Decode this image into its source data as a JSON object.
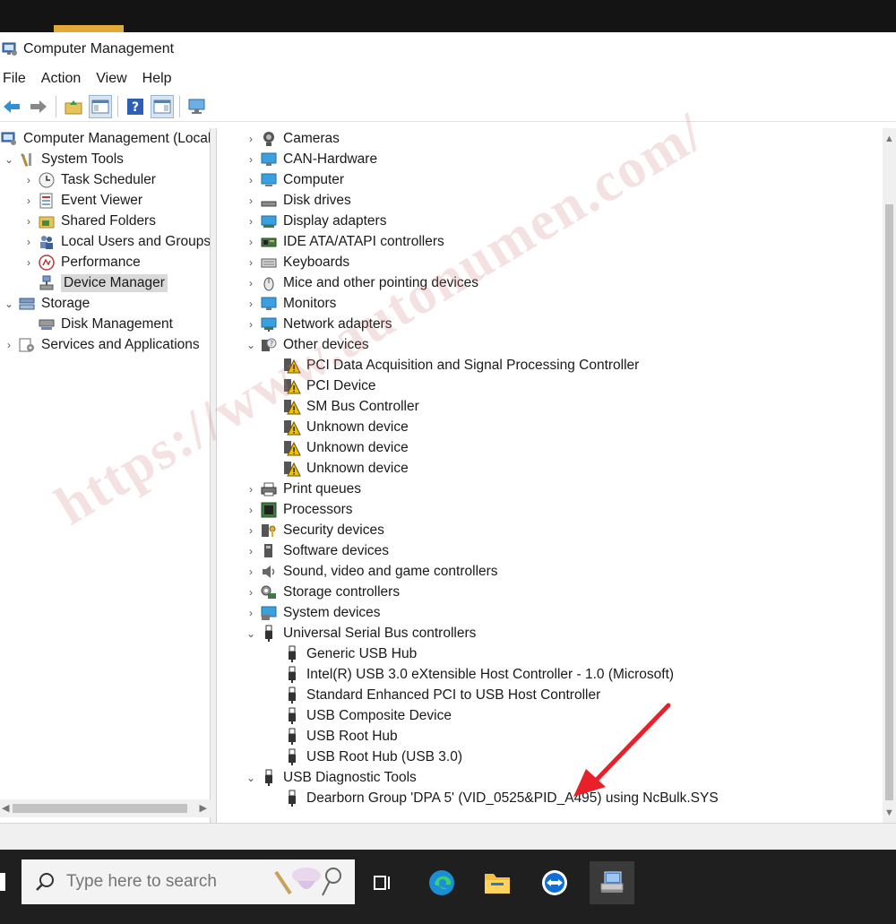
{
  "window": {
    "title": "Computer Management"
  },
  "menu": [
    "File",
    "Action",
    "View",
    "Help"
  ],
  "left_tree": {
    "root": "Computer Management (Local",
    "system_tools": "System Tools",
    "task_scheduler": "Task Scheduler",
    "event_viewer": "Event Viewer",
    "shared_folders": "Shared Folders",
    "local_users": "Local Users and Groups",
    "performance": "Performance",
    "device_manager": "Device Manager",
    "storage": "Storage",
    "disk_management": "Disk Management",
    "services": "Services and Applications"
  },
  "devices": {
    "cameras": "Cameras",
    "can_hardware": "CAN-Hardware",
    "computer": "Computer",
    "disk_drives": "Disk drives",
    "display_adapters": "Display adapters",
    "ide": "IDE ATA/ATAPI controllers",
    "keyboards": "Keyboards",
    "mice": "Mice and other pointing devices",
    "monitors": "Monitors",
    "network_adapters": "Network adapters",
    "other_devices": "Other devices",
    "other_children": [
      "PCI Data Acquisition and Signal Processing Controller",
      "PCI Device",
      "SM Bus Controller",
      "Unknown device",
      "Unknown device",
      "Unknown device"
    ],
    "print_queues": "Print queues",
    "processors": "Processors",
    "security_devices": "Security devices",
    "software_devices": "Software devices",
    "sound": "Sound, video and game controllers",
    "storage_controllers": "Storage controllers",
    "system_devices": "System devices",
    "usb_controllers": "Universal Serial Bus controllers",
    "usb_children": [
      "Generic USB Hub",
      "Intel(R) USB 3.0 eXtensible Host Controller - 1.0 (Microsoft)",
      "Standard Enhanced PCI to USB Host Controller",
      "USB Composite Device",
      "USB Root Hub",
      "USB Root Hub (USB 3.0)"
    ],
    "usb_diag": "USB Diagnostic Tools",
    "usb_diag_children": [
      "Dearborn Group 'DPA 5' (VID_0525&PID_A495) using NcBulk.SYS"
    ]
  },
  "taskbar": {
    "search_placeholder": "Type here to search"
  },
  "watermark": "https://www.autonumen.com/",
  "colors": {
    "annotation_arrow": "#e8202a",
    "warning": "#f2c200",
    "selection": "#d9d9d9"
  }
}
